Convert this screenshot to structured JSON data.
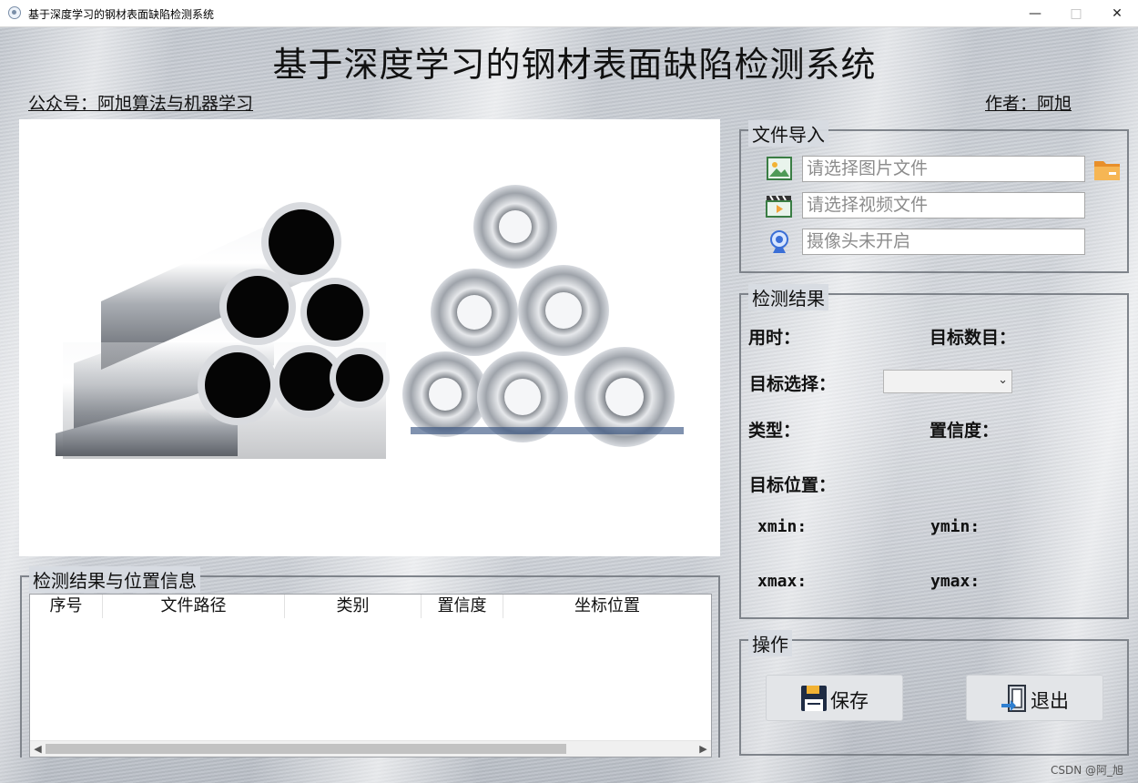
{
  "window": {
    "title": "基于深度学习的钢材表面缺陷检测系统"
  },
  "header": {
    "title": "基于深度学习的钢材表面缺陷检测系统",
    "wechat": "公众号：阿旭算法与机器学习",
    "author": "作者：阿旭"
  },
  "file_import": {
    "legend": "文件导入",
    "image_placeholder": "请选择图片文件",
    "video_placeholder": "请选择视频文件",
    "camera_placeholder": "摄像头未开启"
  },
  "result": {
    "legend": "检测结果",
    "time_label": "用时：",
    "count_label": "目标数目：",
    "select_label": "目标选择：",
    "type_label": "类型：",
    "confidence_label": "置信度：",
    "position_label": "目标位置：",
    "xmin_label": "xmin:",
    "ymin_label": "ymin:",
    "xmax_label": "xmax:",
    "ymax_label": "ymax:"
  },
  "ops": {
    "legend": "操作",
    "save_label": "保存",
    "exit_label": "退出"
  },
  "table": {
    "legend": "检测结果与位置信息",
    "columns": [
      "序号",
      "文件路径",
      "类别",
      "置信度",
      "坐标位置"
    ]
  },
  "watermark": "CSDN @阿_旭",
  "colors": {
    "accent_folder": "#f2a43a",
    "steel": "#b8bdc5"
  }
}
